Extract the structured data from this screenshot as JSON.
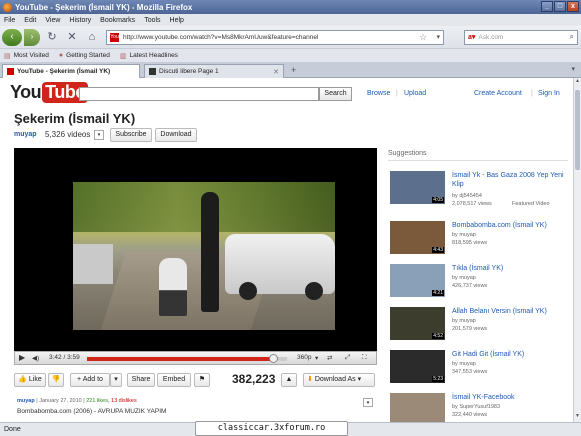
{
  "window": {
    "title": "YouTube - Şekerim (İsmail YK) - Mozilla Firefox"
  },
  "menu": [
    "File",
    "Edit",
    "View",
    "History",
    "Bookmarks",
    "Tools",
    "Help"
  ],
  "navbar": {
    "url": "http://www.youtube.com/watch?v=Ms8MkrAmUuw&feature=channel",
    "search_placeholder": "Ask.com"
  },
  "bookmarks": [
    "Most Visited",
    "Getting Started",
    "Latest Headlines"
  ],
  "tabs": [
    {
      "label": "YouTube - Şekerim (İsmail YK)",
      "active": true
    },
    {
      "label": "Discuti libere Page 1",
      "active": false
    }
  ],
  "youtube": {
    "logo_you": "You",
    "logo_tube": "Tube",
    "search_button": "Search",
    "links": [
      "Browse",
      "Upload",
      "Create Account",
      "Sign In"
    ]
  },
  "video": {
    "title": "Şekerim (İsmail YK)",
    "uploader": "muyap",
    "video_count": "5,326 videos",
    "subscribe": "Subscribe",
    "download": "Download",
    "time": "3:42 / 3:59",
    "progress": 0.93,
    "quality": "360p",
    "views": "382,223",
    "actions": {
      "like": "Like",
      "add_to": "+ Add to",
      "share": "Share",
      "embed": "Embed",
      "download_as": "Download As"
    },
    "meta": {
      "user": "muyap",
      "date": "January 27, 2010",
      "likes": "221 likes,",
      "dislikes": "13 dislikes"
    },
    "description": "Bombabomba.com (2006) - AVRUPA MUZIK YAPIM"
  },
  "suggestions": {
    "heading": "Suggestions",
    "items": [
      {
        "title": "İsmail Yk - Bas Gaza 2008 Yep Yeni Klip",
        "by": "by dj545454",
        "views": "2,078,517 views",
        "extra": "Featured Video",
        "duration": "4:05",
        "color": "#5c6f8c"
      },
      {
        "title": "Bombabomba.com (İsmail YK)",
        "by": "by muyap",
        "views": "818,595 views",
        "extra": "",
        "duration": "4:43",
        "color": "#7a5a3a"
      },
      {
        "title": "Tıkla (İsmail YK)",
        "by": "by muyap",
        "views": "426,737 views",
        "extra": "",
        "duration": "4:21",
        "color": "#8aa0b8"
      },
      {
        "title": "Allah Belanı Versin (İsmail YK)",
        "by": "by muyap",
        "views": "201,579 views",
        "extra": "",
        "duration": "4:52",
        "color": "#3d3d2e"
      },
      {
        "title": "Git Hadi Git (İsmail YK)",
        "by": "by muyap",
        "views": "347,553 views",
        "extra": "",
        "duration": "5:23",
        "color": "#2b2b2b"
      },
      {
        "title": "İsmail YK-Facebook",
        "by": "by SuperYusuf1983",
        "views": "322,440 views",
        "extra": "",
        "duration": "",
        "color": "#9c8a78"
      }
    ]
  },
  "status": {
    "text": "Done",
    "overlay": "classiccar.3xforum.ro"
  }
}
